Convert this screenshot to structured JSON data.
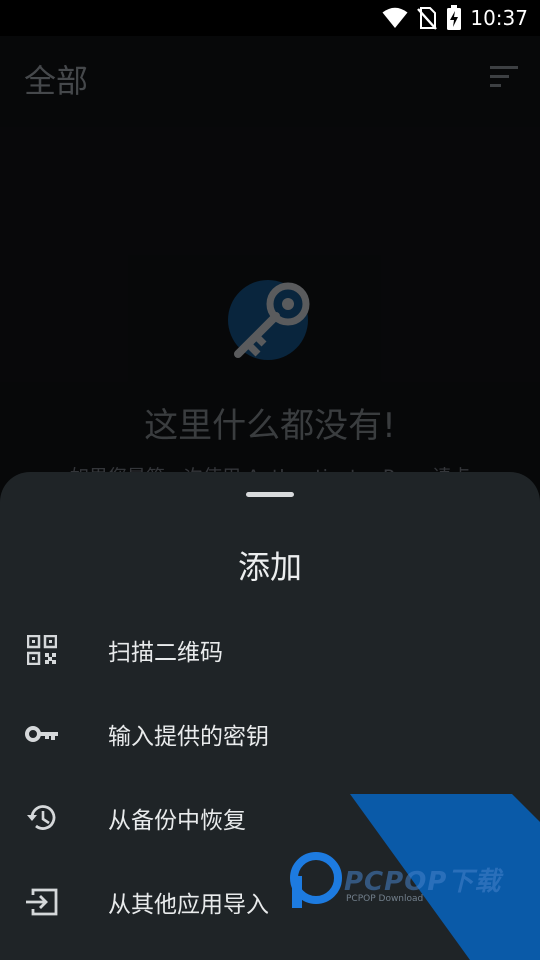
{
  "status_bar": {
    "time": "10:37",
    "icons": [
      "wifi-icon",
      "no-sim-icon",
      "battery-charging-icon"
    ]
  },
  "app": {
    "title": "全部",
    "sort_icon": "sort-icon",
    "empty_state": {
      "icon": "key-icon",
      "title": "这里什么都没有!",
      "subtitle": "如果您是第一次使用 Authenticator Pro，请点"
    }
  },
  "sheet": {
    "title": "添加",
    "options": [
      {
        "label": "扫描二维码",
        "icon": "qr-code-icon"
      },
      {
        "label": "输入提供的密钥",
        "icon": "key-icon"
      },
      {
        "label": "从备份中恢复",
        "icon": "history-icon"
      },
      {
        "label": "从其他应用导入",
        "icon": "import-icon"
      }
    ]
  },
  "watermark": {
    "brand": "PCPOP下载",
    "sub": "PCPOP Download"
  },
  "colors": {
    "sheet_bg": "#1f2427",
    "accent_blue": "#0a5aa8",
    "app_bg": "#0c0d0f"
  }
}
